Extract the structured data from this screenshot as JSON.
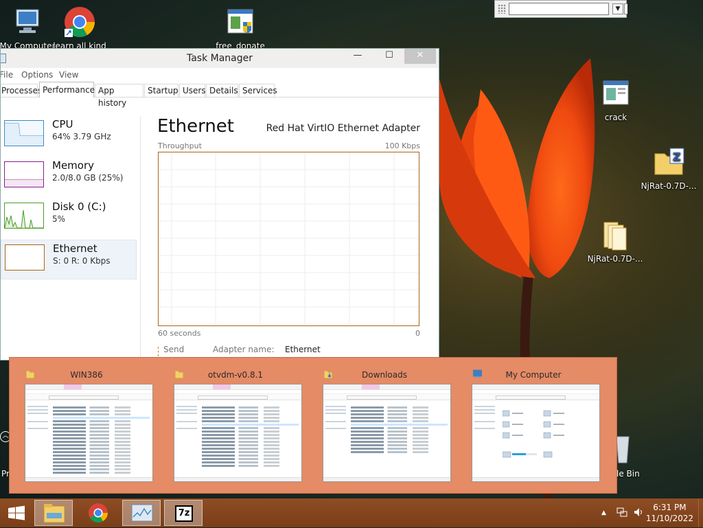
{
  "desktop": {
    "icons": [
      {
        "label": "My Computer",
        "icon": "computer-icon"
      },
      {
        "label": "learn all kind",
        "icon": "chrome-shortcut-icon"
      },
      {
        "label": "free_donate",
        "icon": "installer-shield-icon"
      },
      {
        "label": "crack",
        "icon": "application-icon"
      },
      {
        "label": "NjRat-0.7D-...",
        "icon": "zip-folder-icon"
      },
      {
        "label": "NjRat-0.7D-...",
        "icon": "folder-icon"
      }
    ],
    "partial_left": "Pr",
    "partial_recycle": "le Bin"
  },
  "task_manager": {
    "title": "Task Manager",
    "menu": [
      "File",
      "Options",
      "View"
    ],
    "tabs": [
      "Processes",
      "Performance",
      "App history",
      "Startup",
      "Users",
      "Details",
      "Services"
    ],
    "active_tab": "Performance",
    "resources": [
      {
        "name": "CPU",
        "value": "64%  3.79 GHz",
        "color": "#3d8bc1"
      },
      {
        "name": "Memory",
        "value": "2.0/8.0 GB (25%)",
        "color": "#8b1d8b"
      },
      {
        "name": "Disk 0 (C:)",
        "value": "5%",
        "color": "#4c9a2a"
      },
      {
        "name": "Ethernet",
        "value": "S: 0 R: 0 Kbps",
        "color": "#a7641a"
      }
    ],
    "selected_resource": "Ethernet",
    "detail": {
      "title": "Ethernet",
      "adapter": "Red Hat VirtIO Ethernet Adapter",
      "graph_label": "Throughput",
      "graph_max": "100 Kbps",
      "time_span": "60 seconds",
      "graph_min": "0",
      "send_label": "Send",
      "adapter_name_label": "Adapter name:",
      "adapter_name_value": "Ethernet"
    }
  },
  "switcher": {
    "windows": [
      {
        "title": "WIN386",
        "icon": "folder-icon"
      },
      {
        "title": "otvdm-v0.8.1",
        "icon": "folder-icon"
      },
      {
        "title": "Downloads",
        "icon": "downloads-folder-icon"
      },
      {
        "title": "My Computer",
        "icon": "computer-icon"
      }
    ]
  },
  "taskbar": {
    "buttons": [
      "start-button",
      "file-explorer",
      "chrome",
      "task-manager",
      "7zip"
    ],
    "seven_zip_label": "7z",
    "time": "6:31 PM",
    "date": "11/10/2022"
  },
  "colors": {
    "accent": "#e58b65",
    "taskbar": "#7f421b"
  }
}
